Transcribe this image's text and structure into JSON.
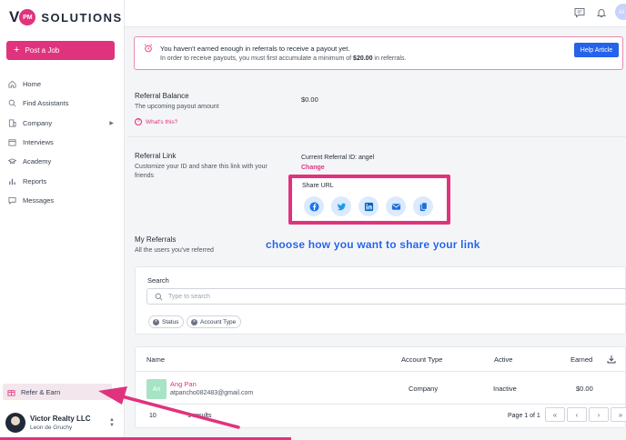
{
  "brand": {
    "logo_v": "V",
    "logo_mark": "PM",
    "logo_text": "SOLUTIONS",
    "accent": "#e0337d",
    "link_blue": "#2563eb"
  },
  "sidebar": {
    "post_job": "Post a Job",
    "items": [
      {
        "label": "Home",
        "icon": "home-icon"
      },
      {
        "label": "Find Assistants",
        "icon": "search-icon"
      },
      {
        "label": "Company",
        "icon": "building-icon"
      },
      {
        "label": "Interviews",
        "icon": "calendar-icon"
      },
      {
        "label": "Academy",
        "icon": "graduation-cap-icon"
      },
      {
        "label": "Reports",
        "icon": "bar-chart-icon"
      },
      {
        "label": "Messages",
        "icon": "message-icon"
      }
    ],
    "refer_label": "Refer & Earn",
    "account": {
      "name": "Victor Realty LLC",
      "user": "Leon de Gruchy"
    }
  },
  "topbar": {
    "avatar": "AI"
  },
  "alert": {
    "title": "You haven't earned enough in referrals to receive a payout yet.",
    "sub_prefix": "In order to receive payouts, you must first accumulate a minimum of",
    "sub_amount": "$20.00",
    "sub_suffix": "in referrals.",
    "help_button": "Help Article"
  },
  "balance": {
    "title": "Referral Balance",
    "desc": "The upcoming payout amount",
    "value": "$0.00",
    "whats_this": "What's this?"
  },
  "link": {
    "title": "Referral Link",
    "desc": "Customize your ID and share this link with your friends",
    "current_id": "Current Referral ID: angel",
    "change": "Change",
    "share_label": "Share URL",
    "share_icons": [
      "facebook-icon",
      "twitter-icon",
      "linkedin-icon",
      "email-icon",
      "copy-icon"
    ]
  },
  "annotation": "choose how you want to share your link",
  "referrals": {
    "title": "My Referrals",
    "desc": "All the users you've referred",
    "search_label": "Search",
    "search_placeholder": "Type to search",
    "filters": [
      "Status",
      "Account Type"
    ]
  },
  "table": {
    "headers": {
      "name": "Name",
      "account_type": "Account Type",
      "active": "Active",
      "earned": "Earned"
    },
    "rows": [
      {
        "initials": "An",
        "name": "Ang Pan",
        "email": "atpancho082483@gmail.com",
        "account_type": "Company",
        "active": "Inactive",
        "earned": "$0.00"
      }
    ],
    "page_size": "10",
    "results": "1 results",
    "page_info": "Page 1 of 1",
    "pager": [
      "«",
      "‹",
      "›",
      "»"
    ]
  }
}
